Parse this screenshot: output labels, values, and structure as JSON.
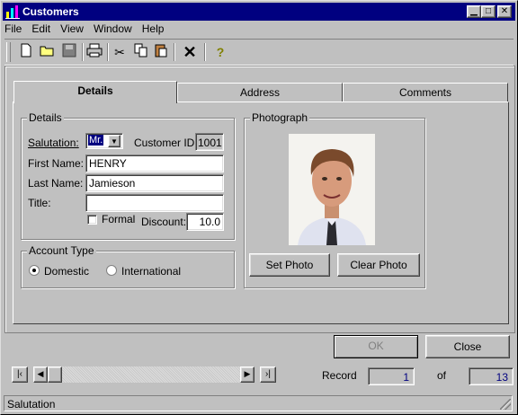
{
  "window": {
    "title": "Customers"
  },
  "menu": [
    "File",
    "Edit",
    "View",
    "Window",
    "Help"
  ],
  "toolbar": [
    "new-file-icon",
    "open-folder-icon",
    "save-disk-icon",
    "print-icon",
    "cut-icon",
    "copy-icon",
    "paste-icon",
    "delete-icon",
    "help-icon"
  ],
  "tabs": [
    "Details",
    "Address",
    "Comments"
  ],
  "details": {
    "group_title": "Details",
    "salutation_label": "Salutation:",
    "salutation_value": "Mr.",
    "customer_id_label": "Customer ID:",
    "customer_id_value": "1001",
    "first_name_label": "First Name:",
    "first_name_value": "HENRY",
    "last_name_label": "Last Name:",
    "last_name_value": "Jamieson",
    "title_label": "Title:",
    "title_value": "",
    "formal_label": "Formal",
    "discount_label": "Discount:",
    "discount_value": "10.0"
  },
  "account_type": {
    "title": "Account Type",
    "domestic": "Domestic",
    "international": "International"
  },
  "photo": {
    "title": "Photograph",
    "set_label": "Set Photo",
    "clear_label": "Clear Photo"
  },
  "buttons": {
    "ok": "OK",
    "close": "Close"
  },
  "record": {
    "label": "Record",
    "current": "1",
    "of": "of",
    "total": "13"
  },
  "status": "Salutation"
}
